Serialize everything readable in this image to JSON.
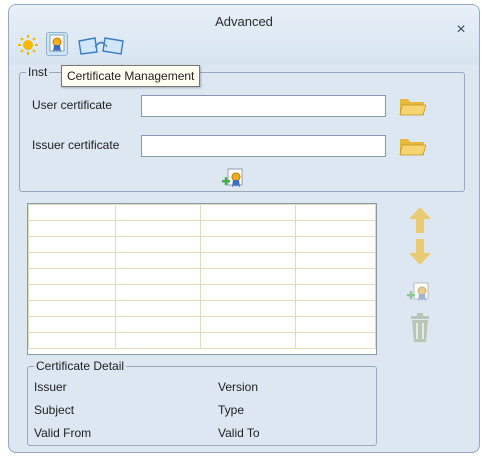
{
  "window": {
    "title": "Advanced",
    "close_glyph": "×"
  },
  "toolbar": {
    "icons": [
      "settings-sun-icon",
      "certificate-icon",
      "wireless-network-icon"
    ],
    "tooltip": "Certificate Management",
    "partial_group_label": "Inst"
  },
  "install": {
    "user_certificate_label": "User certificate",
    "user_certificate_value": "",
    "issuer_certificate_label": "Issuer certificate",
    "issuer_certificate_value": ""
  },
  "certificate_list": {
    "rows": 8,
    "columns": 4
  },
  "detail": {
    "title": "Certificate Detail",
    "issuer": "Issuer",
    "version": "Version",
    "subject": "Subject",
    "type": "Type",
    "valid_from": "Valid From",
    "valid_to": "Valid To"
  },
  "colors": {
    "window_bg": "#dce7f2",
    "folder": "#f2c94c",
    "arrow_disabled": "#e9c96a",
    "icon_disabled": "#aab7a6"
  }
}
